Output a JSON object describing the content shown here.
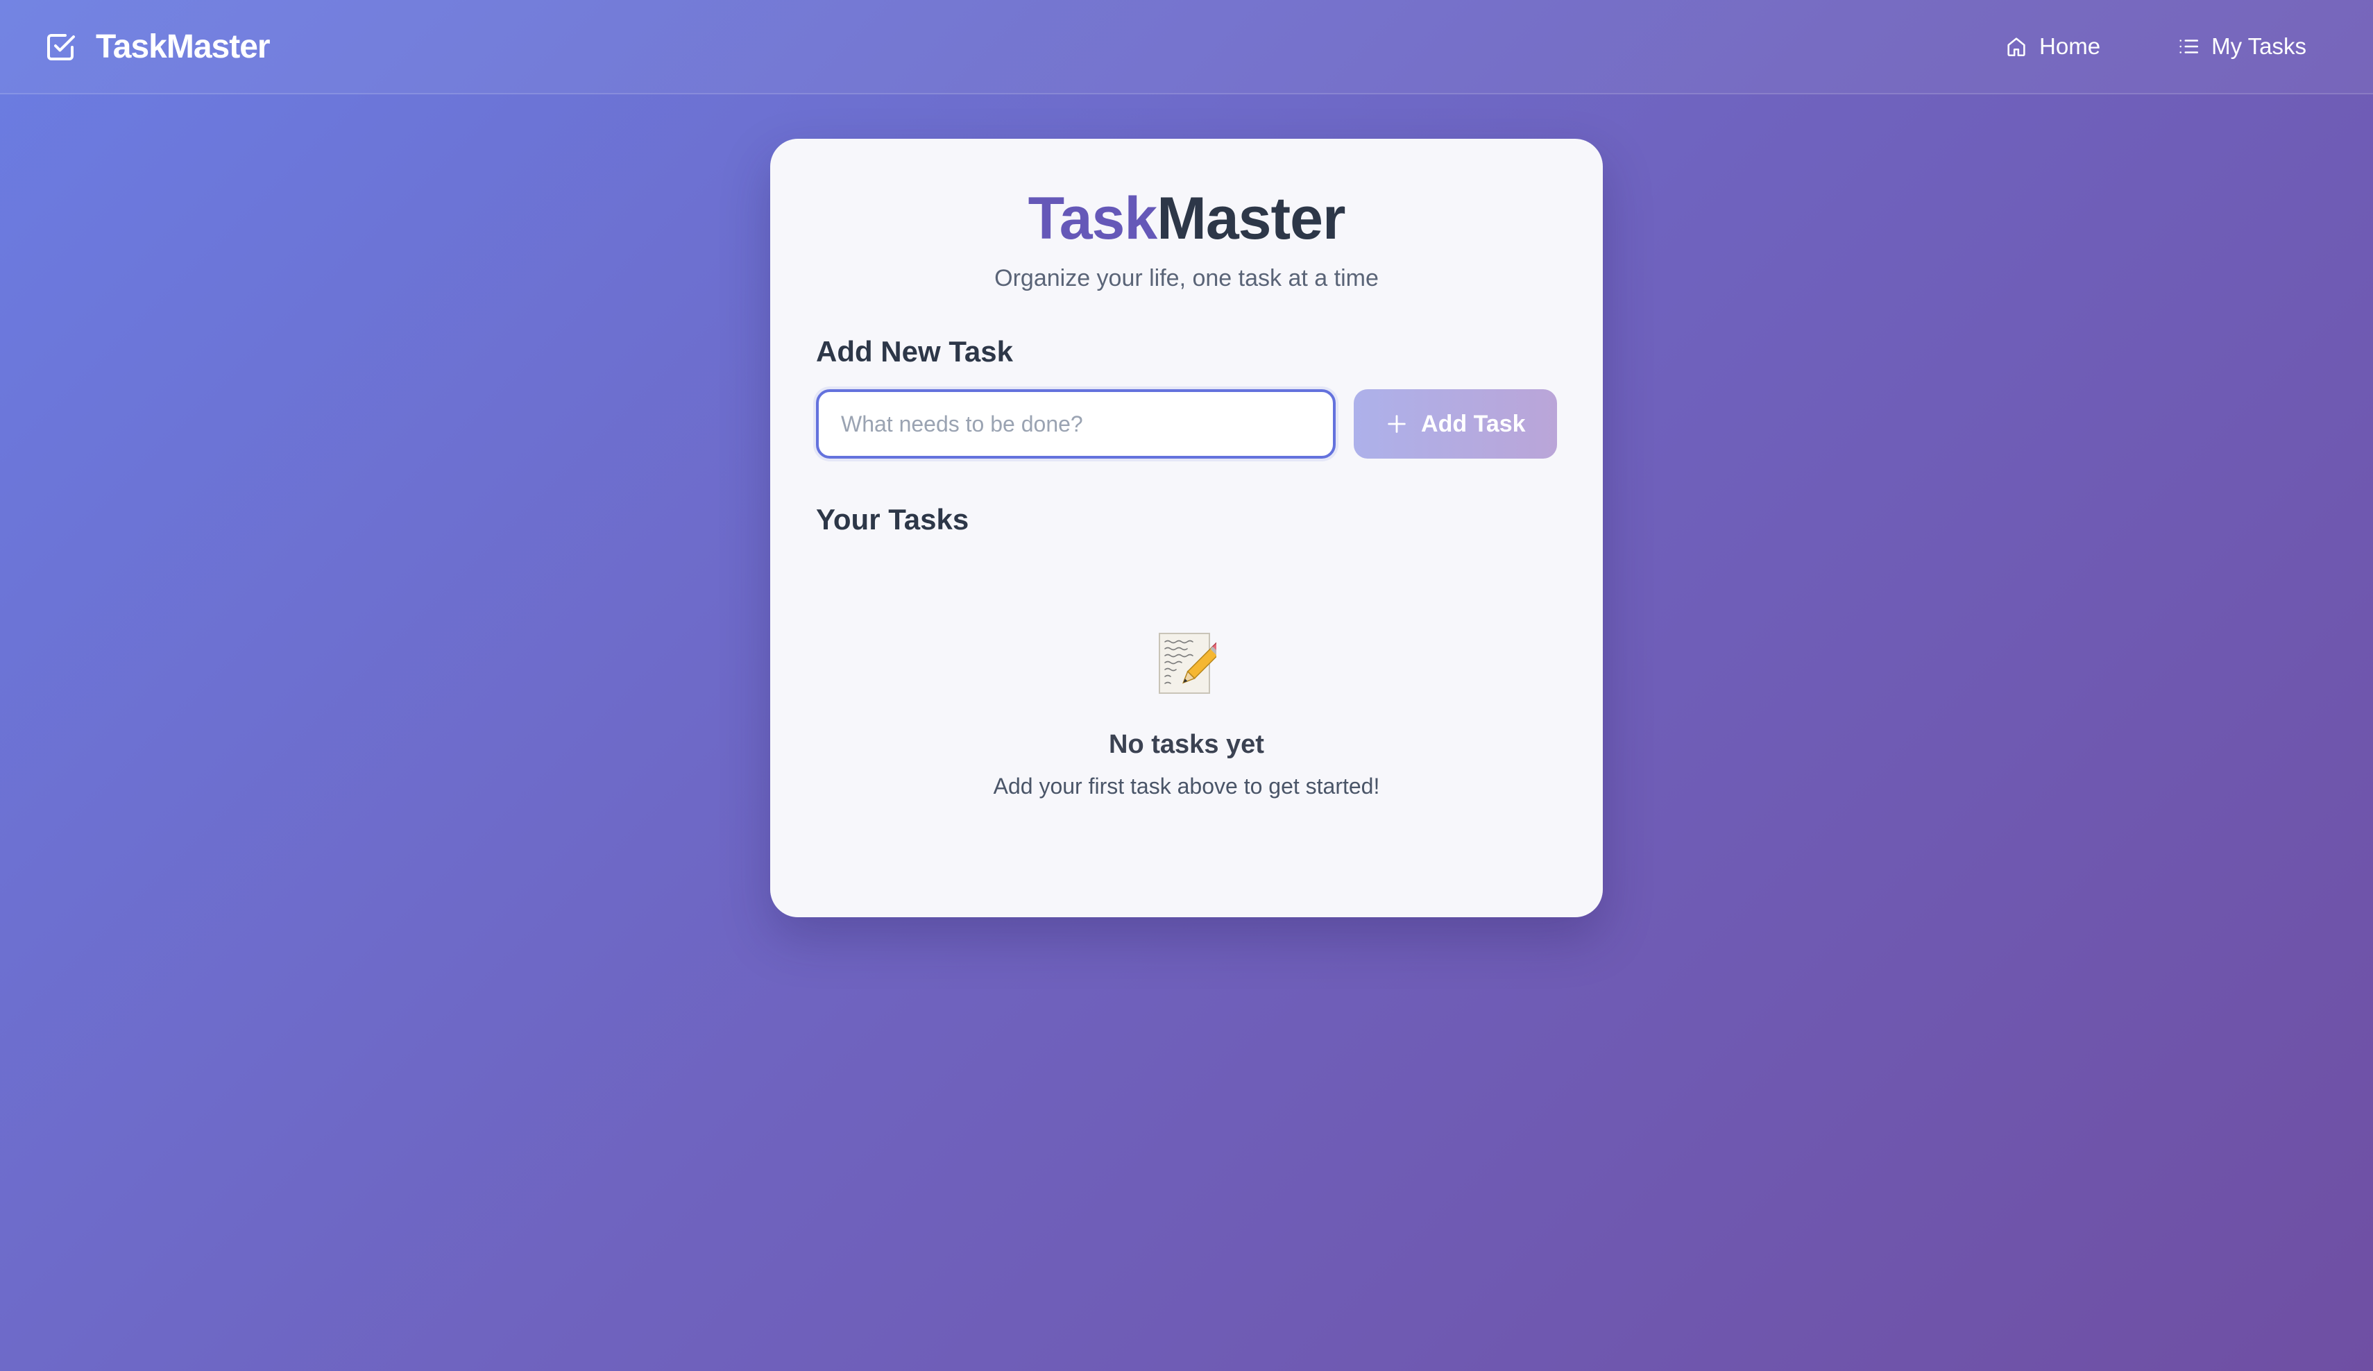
{
  "navbar": {
    "brand_name": "TaskMaster",
    "brand_icon": "checkbox-icon",
    "links": [
      {
        "label": "Home",
        "icon": "home-icon"
      },
      {
        "label": "My Tasks",
        "icon": "list-icon"
      }
    ]
  },
  "hero": {
    "title_accent": "Task",
    "title_rest": "Master",
    "subtitle": "Organize your life, one task at a time"
  },
  "add_task": {
    "heading": "Add New Task",
    "input_value": "",
    "input_placeholder": "What needs to be done?",
    "button_label": "Add Task",
    "button_icon": "plus-icon"
  },
  "tasks": {
    "heading": "Your Tasks",
    "items": [],
    "empty_icon": "memo-icon",
    "empty_title": "No tasks yet",
    "empty_subtitle": "Add your first task above to get started!"
  },
  "colors": {
    "accent": "#6558b8",
    "input_border": "#6472dd",
    "background_start": "#6b7de2",
    "background_end": "#6f4fa3"
  }
}
